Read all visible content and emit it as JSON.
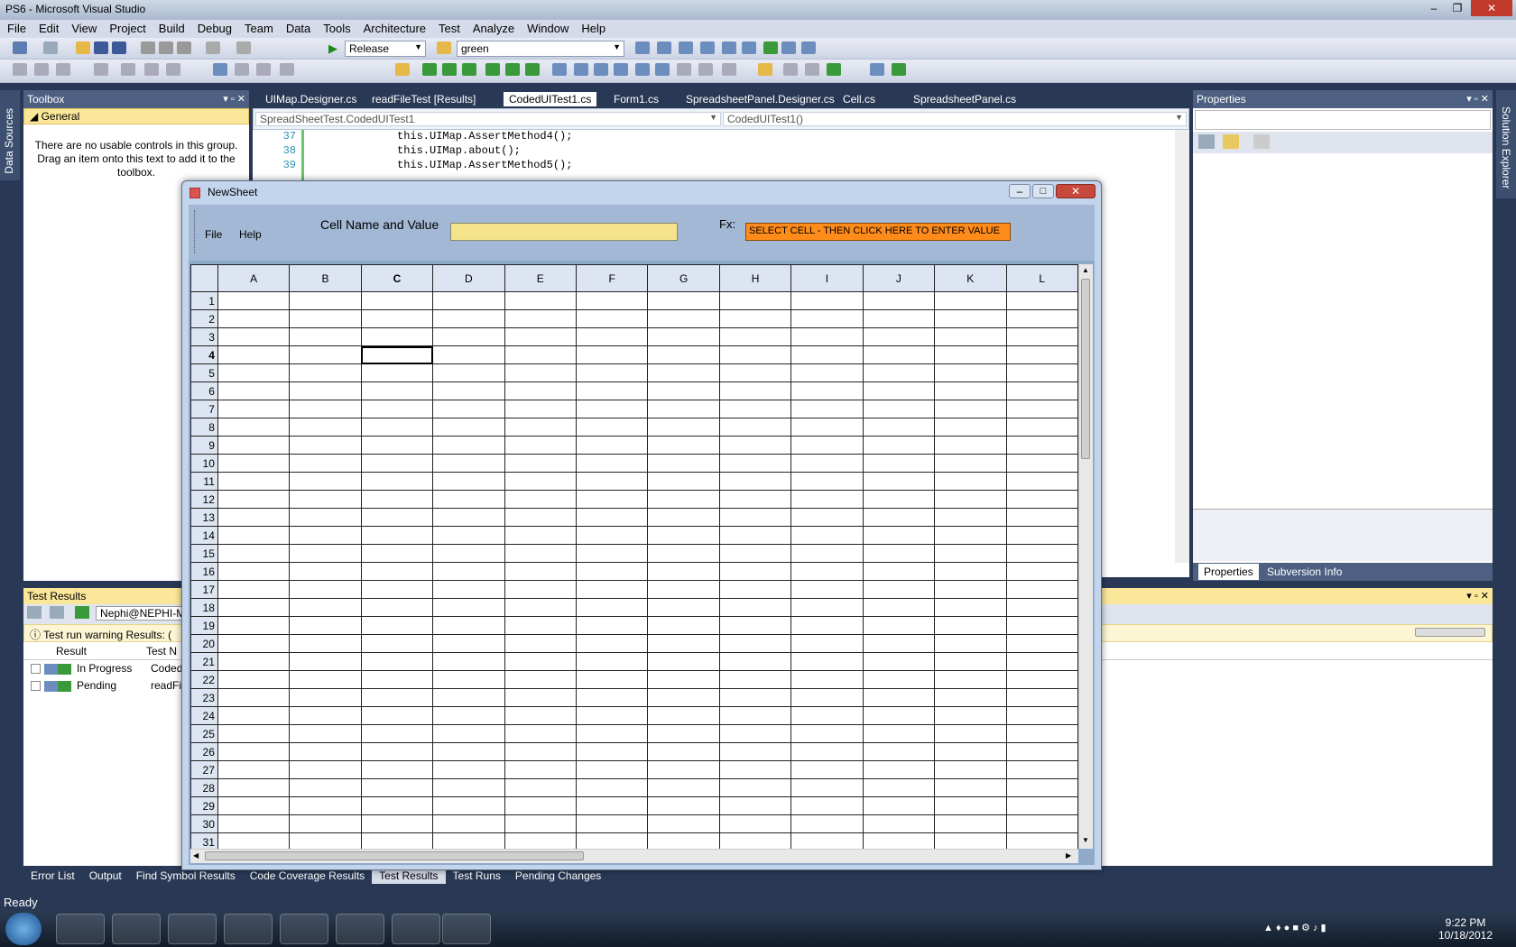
{
  "window": {
    "title": "PS6 - Microsoft Visual Studio"
  },
  "menu": [
    "File",
    "Edit",
    "View",
    "Project",
    "Build",
    "Debug",
    "Team",
    "Data",
    "Tools",
    "Architecture",
    "Test",
    "Analyze",
    "Window",
    "Help"
  ],
  "toolbar": {
    "config": "Release",
    "platform": "green"
  },
  "toolbox": {
    "title": "Toolbox",
    "group": "General",
    "message": "There are no usable controls in this group. Drag an item onto this text to add it to the toolbox."
  },
  "side_tabs": {
    "left": "Data Sources",
    "right": "Solution Explorer"
  },
  "editor": {
    "tabs": [
      "UIMap.Designer.cs",
      "readFileTest [Results]",
      "CodedUITest1.cs",
      "Form1.cs",
      "SpreadsheetPanel.Designer.cs",
      "Cell.cs",
      "SpreadsheetPanel.cs"
    ],
    "active_tab": "CodedUITest1.cs",
    "type_dropdown": "SpreadSheetTest.CodedUITest1",
    "member_dropdown": "CodedUITest1()",
    "lines": [
      {
        "num": "37",
        "code": "this.UIMap.AssertMethod4();"
      },
      {
        "num": "38",
        "code": "this.UIMap.about();"
      },
      {
        "num": "39",
        "code": "this.UIMap.AssertMethod5();"
      }
    ]
  },
  "properties": {
    "title": "Properties",
    "tabs": [
      "Properties",
      "Subversion Info"
    ]
  },
  "test_results": {
    "title": "Test Results",
    "user": "Nephi@NEPHI-M",
    "warning": "Test run warning Results: (",
    "columns": [
      "Result",
      "Test N"
    ],
    "rows": [
      {
        "result": "In Progress",
        "test": "Coded"
      },
      {
        "result": "Pending",
        "test": "readFil"
      }
    ]
  },
  "bottom_tabs": [
    "Error List",
    "Output",
    "Find Symbol Results",
    "Code Coverage Results",
    "Test Results",
    "Test Runs",
    "Pending Changes"
  ],
  "status": "Ready",
  "clock": {
    "time": "9:22 PM",
    "date": "10/18/2012"
  },
  "newsheet": {
    "title": "NewSheet",
    "menu": [
      "File",
      "Help"
    ],
    "cell_label": "Cell Name and Value",
    "fx_label": "Fx:",
    "fx_value": "SELECT CELL - THEN CLICK HERE TO ENTER VALUE",
    "columns": [
      "A",
      "B",
      "C",
      "D",
      "E",
      "F",
      "G",
      "H",
      "I",
      "J",
      "K",
      "L"
    ],
    "rows": [
      "1",
      "2",
      "3",
      "4",
      "5",
      "6",
      "7",
      "8",
      "9",
      "10",
      "11",
      "12",
      "13",
      "14",
      "15",
      "16",
      "17",
      "18",
      "19",
      "20",
      "21",
      "22",
      "23",
      "24",
      "25",
      "26",
      "27",
      "28",
      "29",
      "30",
      "31"
    ],
    "selected": {
      "col": "C",
      "row": "4"
    }
  }
}
